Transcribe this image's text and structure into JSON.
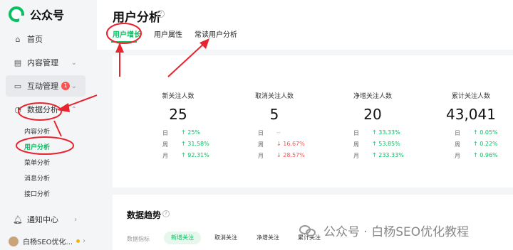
{
  "brand": {
    "name": "公众号"
  },
  "sidebar": {
    "items": [
      {
        "label": "首页",
        "icon": "home-icon"
      },
      {
        "label": "内容管理",
        "icon": "document-icon"
      },
      {
        "label": "互动管理",
        "icon": "chat-icon",
        "badge": "1"
      },
      {
        "label": "数据分析",
        "icon": "analytics-icon"
      }
    ],
    "sub_items": [
      "内容分析",
      "用户分析",
      "菜单分析",
      "消息分析",
      "接口分析"
    ],
    "notice": {
      "label": "通知中心",
      "icon": "bell-icon"
    },
    "user": {
      "name": "白杨SEO优化..."
    }
  },
  "header": {
    "title": "用户分析",
    "tabs": [
      "用户增长",
      "用户属性",
      "常读用户分析"
    ]
  },
  "stats": [
    {
      "label": "新关注人数",
      "value": "25",
      "rows": [
        {
          "k": "日",
          "v": "↑ 25%",
          "dir": "up"
        },
        {
          "k": "周",
          "v": "↑ 31.58%",
          "dir": "up"
        },
        {
          "k": "月",
          "v": "↑ 92.31%",
          "dir": "up"
        }
      ]
    },
    {
      "label": "取消关注人数",
      "value": "5",
      "rows": [
        {
          "k": "日",
          "v": "--",
          "dir": "none"
        },
        {
          "k": "周",
          "v": "↓ 16.67%",
          "dir": "down"
        },
        {
          "k": "月",
          "v": "↓ 28.57%",
          "dir": "down"
        }
      ]
    },
    {
      "label": "净增关注人数",
      "value": "20",
      "rows": [
        {
          "k": "日",
          "v": "↑ 33.33%",
          "dir": "up"
        },
        {
          "k": "周",
          "v": "↑ 53.85%",
          "dir": "up"
        },
        {
          "k": "月",
          "v": "↑ 233.33%",
          "dir": "up"
        }
      ]
    },
    {
      "label": "累计关注人数",
      "value": "43,041",
      "rows": [
        {
          "k": "日",
          "v": "↑ 0.05%",
          "dir": "up"
        },
        {
          "k": "周",
          "v": "↑ 0.22%",
          "dir": "up"
        },
        {
          "k": "月",
          "v": "↑ 0.96%",
          "dir": "up"
        }
      ]
    }
  ],
  "trend": {
    "title": "数据趋势",
    "metric_label": "数据指标",
    "pills": [
      "新增关注",
      "取消关注",
      "净增关注",
      "累计关注"
    ]
  },
  "watermark": {
    "text": "公众号 · 白杨SEO优化教程"
  },
  "colors": {
    "accent": "#07c160",
    "down": "#fa5151",
    "annotation": "#e8242e"
  }
}
